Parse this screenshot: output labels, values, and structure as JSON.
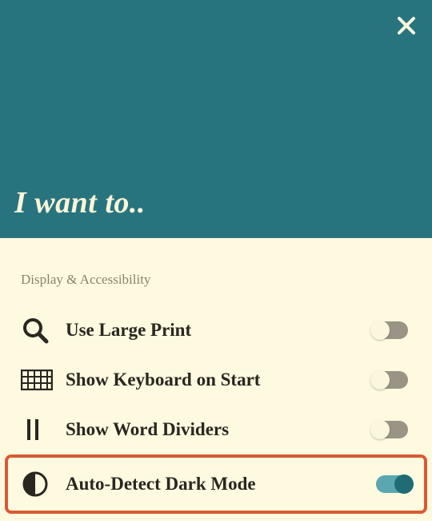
{
  "header": {
    "title": "I want to.."
  },
  "section_label": "Display & Accessibility",
  "rows": [
    {
      "icon": "search",
      "label": "Use Large Print",
      "on": false,
      "highlight": false
    },
    {
      "icon": "keyboard",
      "label": "Show Keyboard on Start",
      "on": false,
      "highlight": false
    },
    {
      "icon": "dividers",
      "label": "Show Word Dividers",
      "on": false,
      "highlight": false
    },
    {
      "icon": "contrast",
      "label": "Auto-Detect Dark Mode",
      "on": true,
      "highlight": true
    }
  ]
}
